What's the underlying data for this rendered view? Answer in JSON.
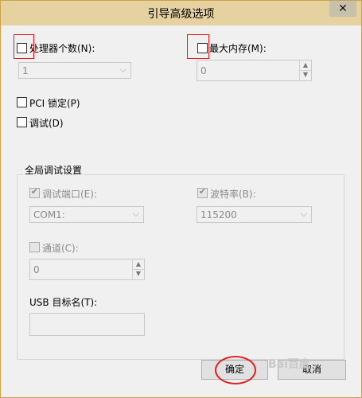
{
  "dialog": {
    "title": "引导高级选项",
    "close_symbol": "✕"
  },
  "processors": {
    "label": "处理器个数(N):",
    "value": "1"
  },
  "max_memory": {
    "label": "最大内存(M):",
    "value": "0"
  },
  "pci_lock": {
    "label": "PCI 锁定(P)"
  },
  "debug": {
    "label": "调试(D)"
  },
  "global_debug": {
    "title": "全局调试设置",
    "debug_port": {
      "label": "调试端口(E):",
      "value": "COM1:"
    },
    "baud_rate": {
      "label": "波特率(B):",
      "value": "115200"
    },
    "channel": {
      "label": "通道(C):",
      "value": "0"
    },
    "usb_target": {
      "label": "USB 目标名(T):",
      "value": ""
    }
  },
  "buttons": {
    "ok": "确定",
    "cancel": "取消"
  },
  "watermark": "Bai百度",
  "accent_color": "#e02020"
}
